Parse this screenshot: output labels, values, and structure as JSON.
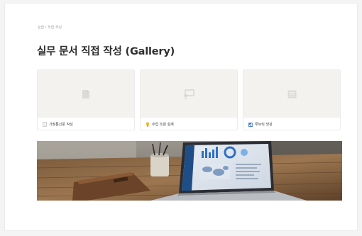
{
  "breadcrumb": "실습 / 직접 작성",
  "page_title": "실무 문서 직접 작성 (Gallery)",
  "cards": [
    {
      "label": "가정통신문 작성",
      "icon": "document-icon",
      "footer_icon": "page-icon"
    },
    {
      "label": "수업 조원 설계",
      "icon": "presentation-icon",
      "footer_icon": "lightbulb-icon"
    },
    {
      "label": "루브릭 생성",
      "icon": "list-icon",
      "footer_icon": "chart-icon"
    }
  ],
  "cover_photo": {
    "icon": "laptop-desk-photo"
  },
  "colors": {
    "page_bg": "#ffffff",
    "outer_bg": "#f4f4f4",
    "card_cover": "#f3f2ef",
    "title_text": "#2f2f2f",
    "muted_text": "#a3a3a3"
  }
}
